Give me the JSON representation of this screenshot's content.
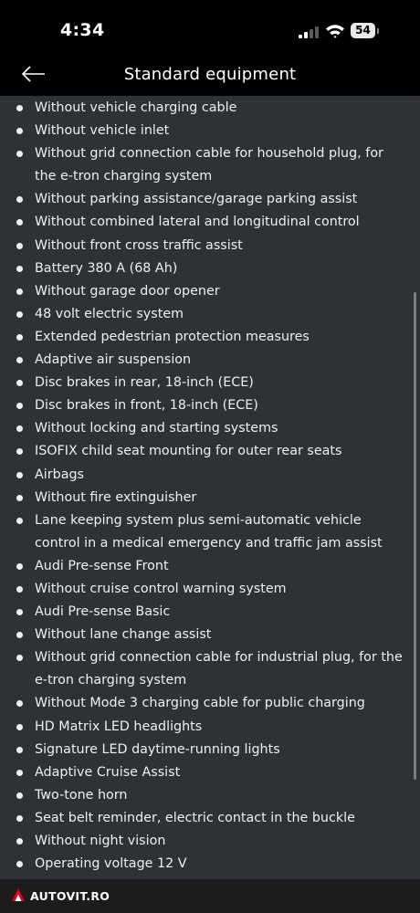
{
  "status_bar": {
    "time": "4:34",
    "battery_level": "54"
  },
  "header": {
    "title": "Standard equipment",
    "back_icon": "arrow-left-icon"
  },
  "equipment_items": [
    "Without vehicle charging cable",
    "Without vehicle inlet",
    "Without grid connection cable for household plug, for the e-tron charging system",
    "Without parking assistance/garage parking assist",
    "Without combined lateral and longitudinal control",
    "Without front cross traffic assist",
    "Battery 380 A (68 Ah)",
    "Without garage door opener",
    "48 volt electric system",
    "Extended pedestrian protection measures",
    "Adaptive air suspension",
    "Disc brakes in rear, 18-inch (ECE)",
    "Disc brakes in front, 18-inch (ECE)",
    "Without locking and starting systems",
    "ISOFIX child seat mounting for outer rear seats",
    "Airbags",
    "Without fire extinguisher",
    "Lane keeping system plus semi-automatic vehicle control in a medical emergency and traffic jam assist",
    "Audi Pre-sense Front",
    "Without cruise control warning system",
    "Audi Pre-sense Basic",
    "Without lane change assist",
    "Without grid connection cable for industrial plug, for the e-tron charging system",
    "Without Mode 3 charging cable for public charging",
    "HD Matrix LED headlights",
    "Signature LED daytime-running lights",
    "Adaptive Cruise Assist",
    "Two-tone horn",
    "Seat belt reminder, electric contact in the buckle",
    "Without night vision",
    "Operating voltage 12 V"
  ],
  "footer": {
    "brand": "AUTOVIT.RO"
  },
  "colors": {
    "content_background": "#2e3136",
    "header_background": "#000000",
    "footer_background": "#1c1c1c",
    "logo_accent": "#e2001a"
  }
}
